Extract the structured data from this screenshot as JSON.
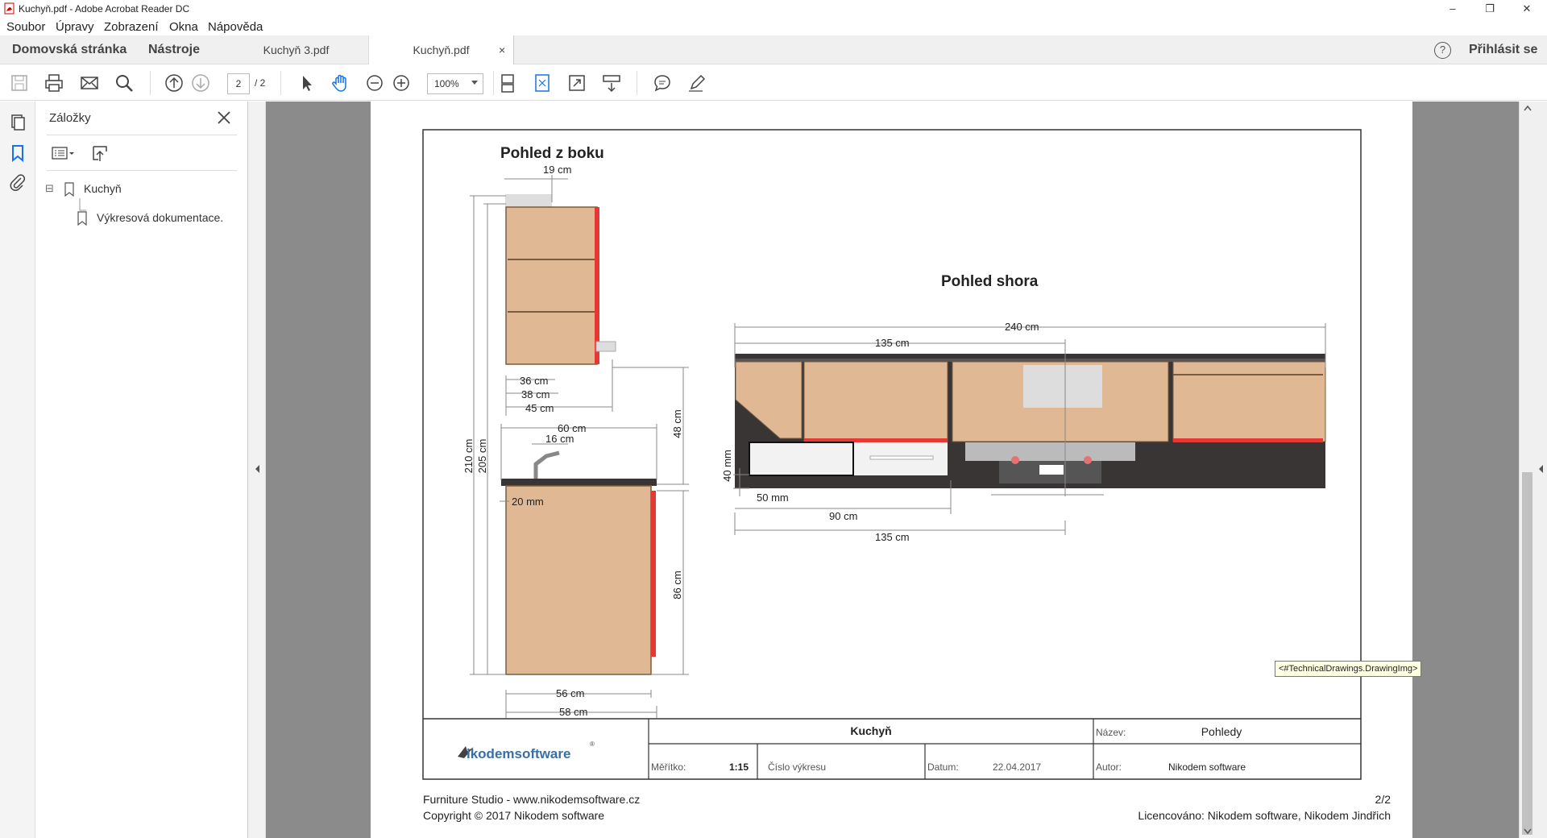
{
  "window": {
    "title": "Kuchyň.pdf - Adobe Acrobat Reader DC",
    "minimize": "–",
    "restore": "❐",
    "close": "✕"
  },
  "menu": [
    "Soubor",
    "Úpravy",
    "Zobrazení",
    "Okna",
    "Nápověda"
  ],
  "tabs": {
    "home": "Domovská stránka",
    "tools": "Nástroje",
    "docs": [
      "Kuchyň 3.pdf",
      "Kuchyň.pdf"
    ],
    "close": "×",
    "help": "?",
    "signin": "Přihlásit se"
  },
  "toolbar": {
    "page_current": "2",
    "page_total": "/ 2",
    "zoom": "100%"
  },
  "bookmarks": {
    "header": "Záložky",
    "items": [
      {
        "label": "Kuchyň",
        "toggle": "⊟"
      },
      {
        "label": "Výkresová dokumentace."
      }
    ]
  },
  "drawing": {
    "side_title": "Pohled z boku",
    "top_title": "Pohled shora",
    "side_dims": {
      "d19": "19 cm",
      "d36": "36 cm",
      "d38": "38 cm",
      "d45": "45 cm",
      "d60": "60 cm",
      "d16": "16 cm",
      "d20": "20 mm",
      "d56": "56 cm",
      "d58": "58 cm",
      "d210": "210 cm",
      "d205": "205 cm",
      "d48": "48 cm",
      "d86": "86 cm"
    },
    "top_dims": {
      "d240": "240 cm",
      "d135a": "135 cm",
      "d40": "40 mm",
      "d50": "50 mm",
      "d90": "90 cm",
      "d135b": "135 cm"
    },
    "titleblock": {
      "logo": "ikodemsoftware",
      "logo_reg": "®",
      "project": "Kuchyň",
      "name_label": "Název:",
      "name_value": "Pohledy",
      "scale_label": "Měřítko:",
      "scale_value": "1:15",
      "drawing_no_label": "Číslo výkresu",
      "date_label": "Datum:",
      "date_value": "22.04.2017",
      "author_label": "Autor:",
      "author_value": "Nikodem software"
    }
  },
  "footer": {
    "left1": "Furniture Studio - www.nikodemsoftware.cz",
    "left2": "Copyright © 2017 Nikodem software",
    "right1": "2/2",
    "right2": "Licencováno:  Nikodem software, Nikodem Jindřich"
  },
  "tooltip": "<#TechnicalDrawings.DrawingImg>",
  "colors": {
    "wood": "#e0b894",
    "accent_red": "#e53935",
    "counter": "#3a3535",
    "dim_line": "#777777"
  }
}
